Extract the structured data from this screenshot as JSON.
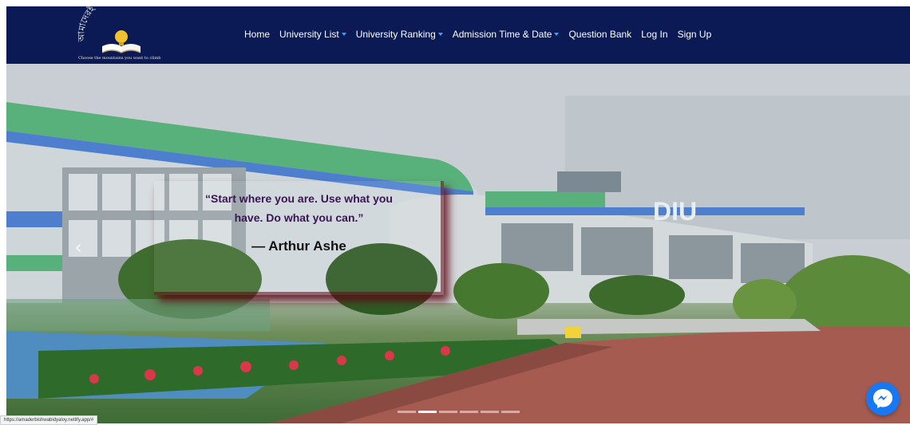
{
  "brand": {
    "logo_text": "আমাদেরই বিশ্ববিদ্যালয়",
    "tagline": "Choose the mountains you want to climb"
  },
  "nav": {
    "items": [
      {
        "label": "Home",
        "dropdown": false
      },
      {
        "label": "University List",
        "dropdown": true
      },
      {
        "label": "University Ranking",
        "dropdown": true
      },
      {
        "label": "Admission Time & Date",
        "dropdown": true
      },
      {
        "label": "Question Bank",
        "dropdown": false
      },
      {
        "label": "Log In",
        "dropdown": false
      },
      {
        "label": "Sign Up",
        "dropdown": false
      }
    ]
  },
  "hero": {
    "quote": "“Start where you are. Use what you have. Do what you can.”",
    "author": "— Arthur Ashe",
    "building_sign": "DIU",
    "slide_count": 6,
    "active_slide": 2
  },
  "status_bar": {
    "url": "https://amaderbishwabidyaloy.netlify.app/#"
  },
  "colors": {
    "nav_bg": "#0b1a55",
    "caret": "#3aa1ff",
    "quote_text": "#3b1357",
    "quote_shadow": "#5a0a14",
    "messenger": "#1877f2"
  },
  "icons": {
    "prev": "chevron-left-icon",
    "chat": "messenger-icon"
  }
}
